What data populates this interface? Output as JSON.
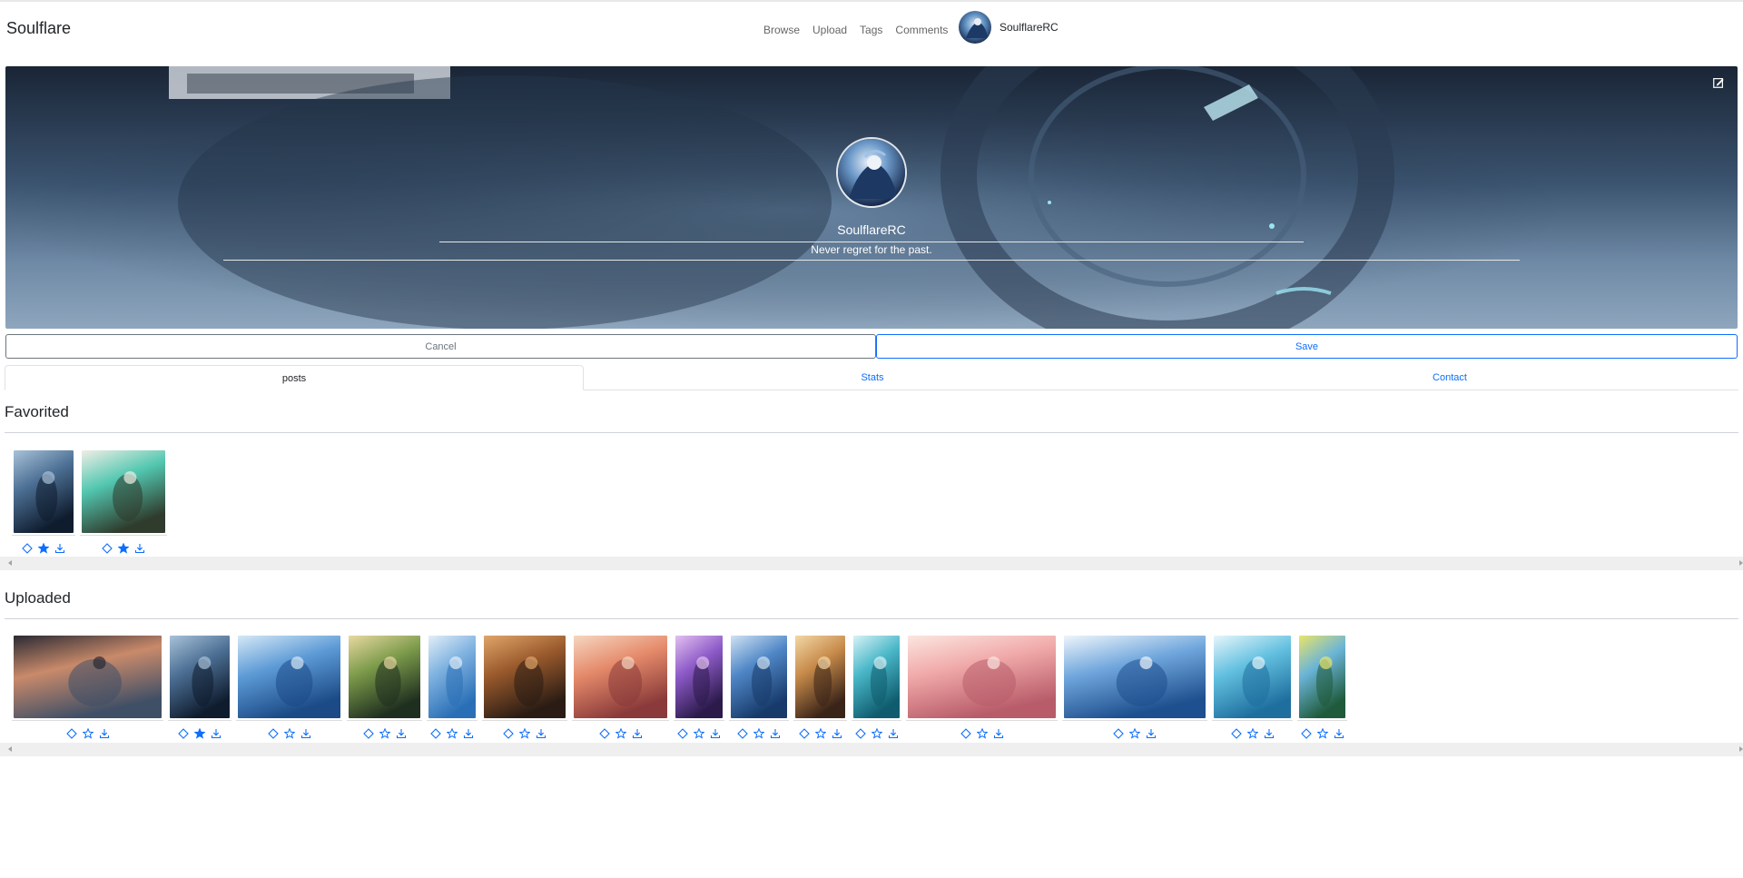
{
  "nav": {
    "brand": "Soulflare",
    "links": [
      "Browse",
      "Upload",
      "Tags",
      "Comments"
    ],
    "user": "SoulflareRC"
  },
  "profile": {
    "name": "SoulflareRC",
    "bio": "Never regret for the past."
  },
  "buttons": {
    "cancel": "Cancel",
    "save": "Save"
  },
  "tabs": [
    "posts",
    "Stats",
    "Contact"
  ],
  "sections": {
    "favorited": {
      "title": "Favorited",
      "items": [
        {
          "thumb": "night-street-figure",
          "favorited": true
        },
        {
          "thumb": "green-hair-flowers",
          "favorited": true
        }
      ]
    },
    "uploaded": {
      "title": "Uploaded",
      "items": [
        {
          "thumb": "sunset-city-street",
          "favorited": false
        },
        {
          "thumb": "night-street-figure",
          "favorited": true
        },
        {
          "thumb": "underwater-girl",
          "favorited": false
        },
        {
          "thumb": "forest-poster",
          "favorited": false
        },
        {
          "thumb": "blue-sky-tower",
          "favorited": false
        },
        {
          "thumb": "dark-portrait",
          "favorited": false
        },
        {
          "thumb": "sunset-sparkles",
          "favorited": false
        },
        {
          "thumb": "purple-concert",
          "favorited": false
        },
        {
          "thumb": "blue-splash",
          "favorited": false
        },
        {
          "thumb": "golden-corridor",
          "favorited": false
        },
        {
          "thumb": "teal-mermaid",
          "favorited": false
        },
        {
          "thumb": "pink-train-station",
          "favorited": false
        },
        {
          "thumb": "cloud-sea-girl",
          "favorited": false
        },
        {
          "thumb": "ocean-dancer",
          "favorited": false
        },
        {
          "thumb": "green-yellow-abstract",
          "favorited": false
        }
      ]
    }
  },
  "icons": {
    "edit": "edit-icon",
    "like": "diamond-icon",
    "favorite": "star-icon",
    "download": "download-icon"
  },
  "colors": {
    "accent": "#0d6efd",
    "muted": "#6c757d"
  }
}
